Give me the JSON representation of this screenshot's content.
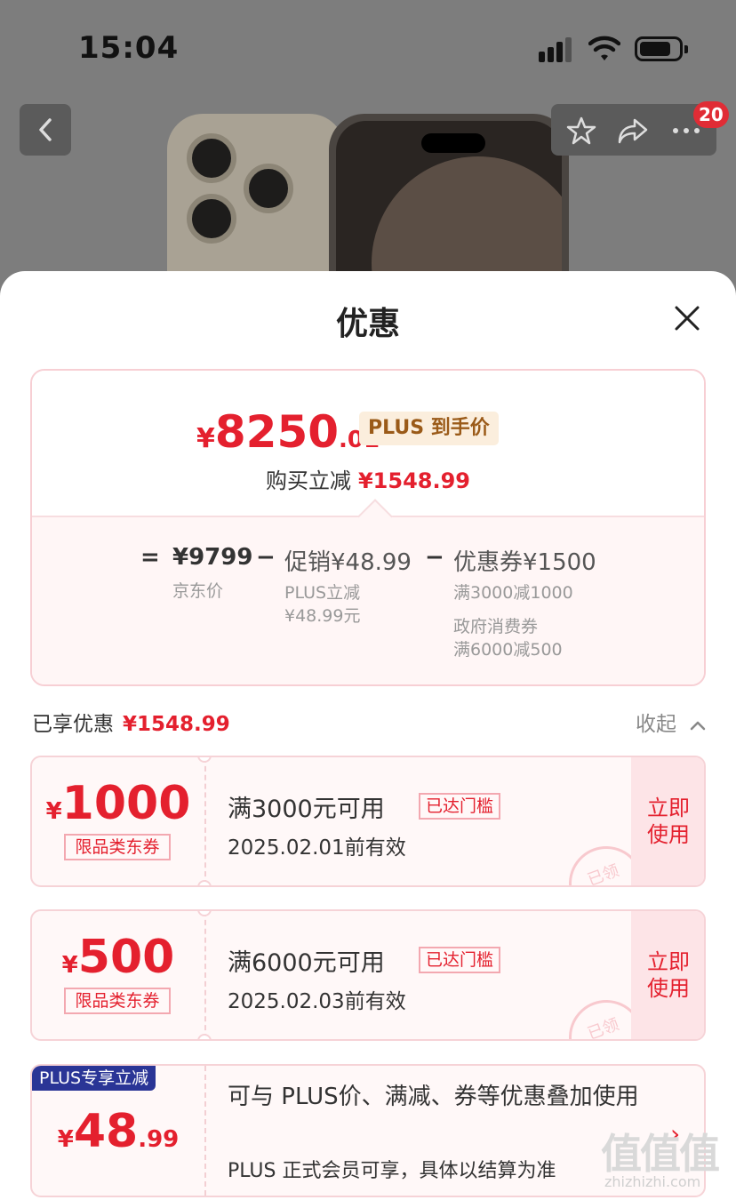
{
  "status_bar": {
    "time": "15:04"
  },
  "header": {
    "cart_badge": "20"
  },
  "icons": {
    "back": "chevron-left-icon",
    "favorite": "star-icon",
    "share": "share-icon",
    "more": "more-icon",
    "close": "close-icon"
  },
  "sheet": {
    "title": "优惠"
  },
  "price_card": {
    "currency": "¥",
    "price_int": "8250",
    "price_dec": ".01",
    "tag": "PLUS 到手价",
    "save_label": "购买立减",
    "save_amount": "¥1548.99",
    "breakdown": {
      "equals": "=",
      "jd_price": "¥9799",
      "jd_price_label": "京东价",
      "minus1": "−",
      "promo": "促销¥48.99",
      "promo_sub": "PLUS立减",
      "promo_sub2": "¥48.99元",
      "minus2": "−",
      "coupon": "优惠券¥1500",
      "coupon_sub1": "满3000减1000",
      "coupon_sub2": "政府消费券",
      "coupon_sub3": "满6000减500"
    }
  },
  "enjoyed": {
    "label": "已享优惠",
    "amount": "¥1548.99",
    "collapse": "收起"
  },
  "coupons": [
    {
      "currency": "¥",
      "amount": "1000",
      "tag": "限品类东券",
      "title": "满3000元可用",
      "threshold": "已达门槛",
      "valid": "2025.02.01前有效",
      "action_1": "立即",
      "action_2": "使用",
      "stamp": "已领"
    },
    {
      "currency": "¥",
      "amount": "500",
      "tag": "限品类东券",
      "title": "满6000元可用",
      "threshold": "已达门槛",
      "valid": "2025.02.03前有效",
      "action_1": "立即",
      "action_2": "使用",
      "stamp": "已领"
    }
  ],
  "plus_card": {
    "badge": "PLUS专享立减",
    "currency": "¥",
    "amount_int": "48",
    "amount_dec": ".99",
    "desc": "可与 PLUS价、满减、券等优惠叠加使用",
    "note": "PLUS 正式会员可享，具体以结算为准"
  },
  "watermark": {
    "logo": "值值值",
    "text": "zhizhizhi.com"
  },
  "colors": {
    "accent": "#e4202e",
    "plus_blue": "#2a3596",
    "tag_gold": "#9a5a18"
  }
}
